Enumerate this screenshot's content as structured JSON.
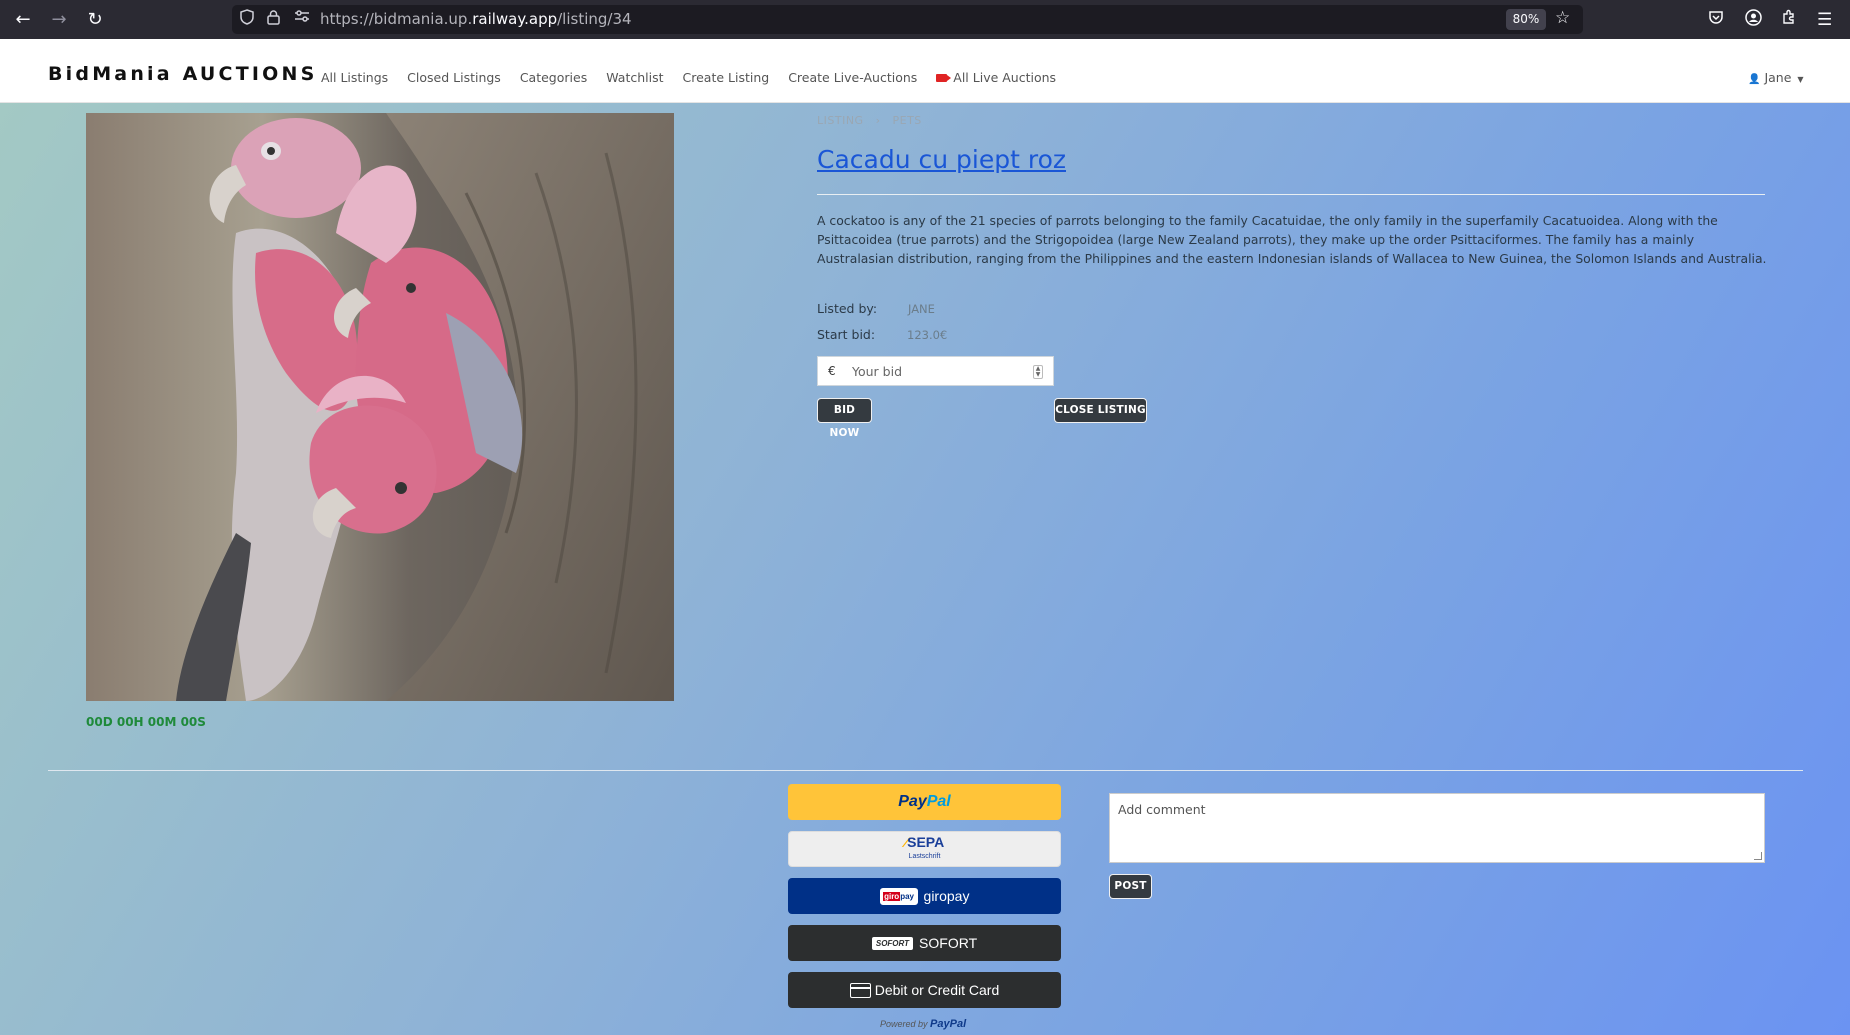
{
  "browser": {
    "url_prefix": "https://bidmania.up.",
    "url_domain": "railway.app",
    "url_path": "/listing/34",
    "zoom": "80%"
  },
  "nav": {
    "brand": "BidMania AUCTIONS",
    "links": [
      "All Listings",
      "Closed Listings",
      "Categories",
      "Watchlist",
      "Create Listing",
      "Create Live-Auctions",
      "All Live Auctions"
    ],
    "user": "Jane"
  },
  "listing": {
    "breadcrumb": [
      "LISTING",
      "›",
      "PETS"
    ],
    "title": "Cacadu cu piept roz",
    "description": "A cockatoo is any of the 21 species of parrots belonging to the family Cacatuidae, the only family in the superfamily Cacatuoidea. Along with the Psittacoidea (true parrots) and the Strigopoidea (large New Zealand parrots), they make up the order Psittaciformes. The family has a mainly Australasian distribution, ranging from the Philippines and the eastern Indonesian islands of Wallacea to New Guinea, the Solomon Islands and Australia.",
    "listed_by_label": "Listed by:",
    "listed_by": "JANE",
    "start_bid_label": "Start bid:",
    "start_bid": "123.0€",
    "currency": "€",
    "bid_placeholder": "Your bid",
    "bid_button": "BID NOW",
    "close_button": "CLOSE LISTING",
    "timer": "00D 00H 00M 00S"
  },
  "payments": {
    "paypal": "PayPal",
    "sepa": "SEPA",
    "sepa_sub": "Lastschrift",
    "giropay": "giropay",
    "sofort": "SOFORT",
    "sofort_badge": "SOFORT",
    "card": "Debit or Credit Card",
    "powered_by": "Powered by",
    "powered_brand": "PayPal"
  },
  "comments": {
    "placeholder": "Add comment",
    "post_button": "POST"
  },
  "colors": {
    "paypal_yellow": "#ffc439",
    "giropay_blue": "#003087",
    "dark_button": "#2c2e2f",
    "title_link": "#1a56d6",
    "timer_green": "#1f8a3a"
  }
}
